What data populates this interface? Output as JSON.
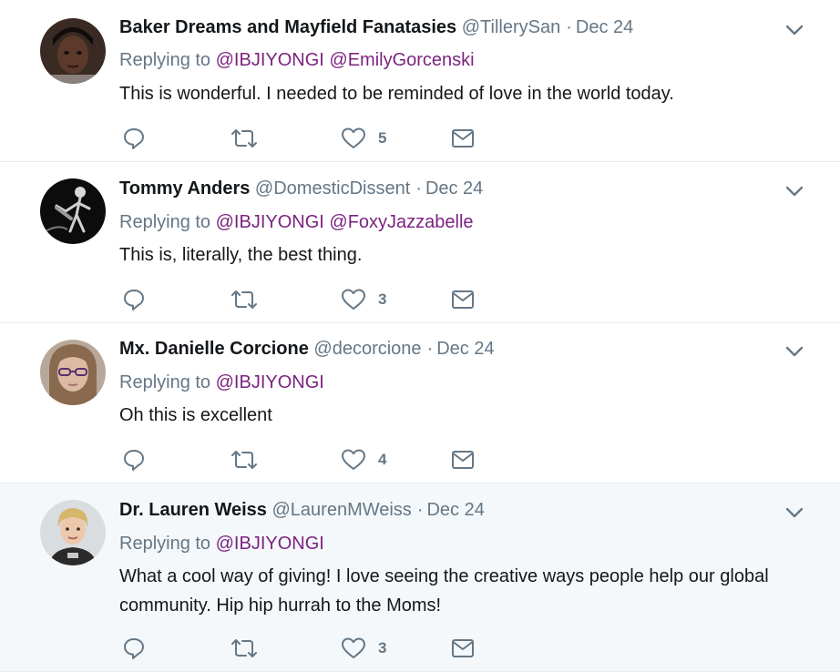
{
  "tweets": [
    {
      "name": "Baker Dreams and Mayfield Fanatasies",
      "handle": "@TillerySan",
      "separator": "·",
      "date": "Dec 24",
      "replying_prefix": "Replying to",
      "mentions": [
        "@IBJIYONGI",
        "@EmilyGorcenski"
      ],
      "text": "This is wonderful. I needed to be reminded of love in the world today.",
      "like_count": "5",
      "avatar_icon": "dark-portrait-avatar"
    },
    {
      "name": "Tommy Anders",
      "handle": "@DomesticDissent",
      "separator": "·",
      "date": "Dec 24",
      "replying_prefix": "Replying to",
      "mentions": [
        "@IBJIYONGI",
        "@FoxyJazzabelle"
      ],
      "text": "This is, literally, the best thing.",
      "like_count": "3",
      "avatar_icon": "skeleton-guitarist-avatar"
    },
    {
      "name": "Mx. Danielle Corcione",
      "handle": "@decorcione",
      "separator": "·",
      "date": "Dec 24",
      "replying_prefix": "Replying to",
      "mentions": [
        "@IBJIYONGI"
      ],
      "text": "Oh this is excellent",
      "like_count": "4",
      "avatar_icon": "glasses-portrait-avatar"
    },
    {
      "name": "Dr. Lauren Weiss",
      "handle": "@LaurenMWeiss",
      "separator": "·",
      "date": "Dec 24",
      "replying_prefix": "Replying to",
      "mentions": [
        "@IBJIYONGI"
      ],
      "text": "What a cool way of giving! I love seeing the creative ways people help our global community. Hip hip hurrah to the Moms!",
      "like_count": "3",
      "avatar_icon": "blonde-portrait-avatar"
    }
  ],
  "colors": {
    "mention": "#7b2380",
    "secondary_text": "#657786",
    "divider": "#e6ecf0",
    "highlight_bg": "#f5f8fa"
  }
}
